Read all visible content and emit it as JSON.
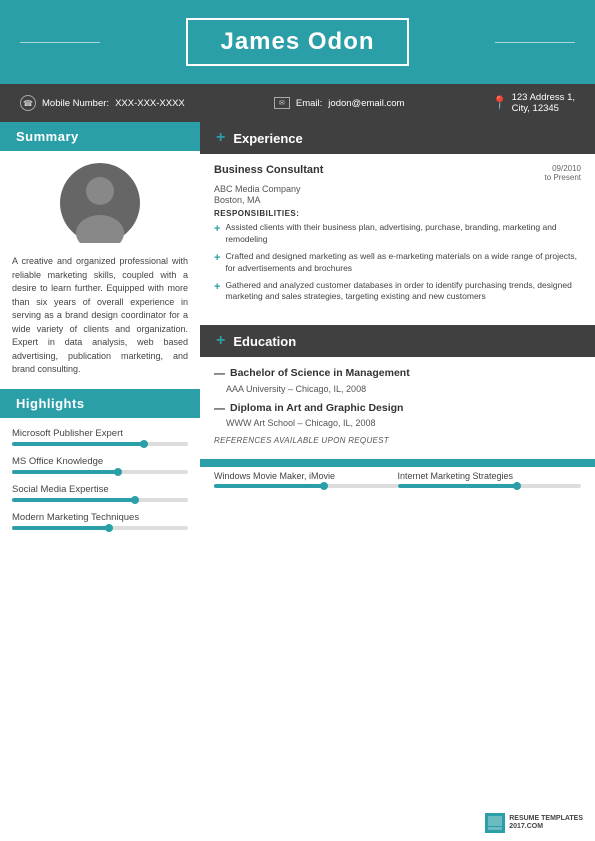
{
  "header": {
    "name": "James Odon"
  },
  "contact": {
    "phone_label": "Mobile Number:",
    "phone_value": "XXX-XXX-XXXX",
    "email_label": "Email:",
    "email_value": "jodon@email.com",
    "address_line1": "123 Address 1,",
    "address_line2": "City, 12345"
  },
  "summary": {
    "section_title": "Summary",
    "text": "A creative and organized professional with reliable marketing skills, coupled with a desire to learn further. Equipped with more than six years of overall experience in serving as a brand design coordinator for a wide variety of clients and organization. Expert in data analysis, web based advertising, publication marketing, and brand consulting."
  },
  "highlights": {
    "section_title": "Highlights",
    "items": [
      {
        "label": "Microsoft Publisher Expert",
        "percent": 75
      },
      {
        "label": "MS Office Knowledge",
        "percent": 60
      },
      {
        "label": "Social Media Expertise",
        "percent": 70
      },
      {
        "label": "Modern Marketing Techniques",
        "percent": 55
      }
    ]
  },
  "experience": {
    "section_title": "Experience",
    "jobs": [
      {
        "title": "Business Consultant",
        "date_start": "09/2010",
        "date_end": "to Present",
        "company": "ABC Media Company",
        "location": "Boston, MA",
        "responsibilities_label": "RESPONSIBILITIES:",
        "responsibilities": [
          "Assisted clients with their business plan, advertising, purchase, branding, marketing and remodeling",
          "Crafted and designed marketing as well as e-marketing materials on a wide range of projects, for advertisements and brochures",
          "Gathered and analyzed customer databases in order to identify purchasing trends, designed marketing and sales strategies, targeting existing and new customers"
        ]
      }
    ]
  },
  "education": {
    "section_title": "Education",
    "entries": [
      {
        "title": "Bachelor of Science in Management",
        "school": "AAA University – Chicago, IL, 2008"
      },
      {
        "title": "Diploma in Art and Graphic Design",
        "school": "WWW Art School – Chicago, IL, 2008"
      }
    ],
    "references": "REFERENCES AVAILABLE UPON REQUEST"
  },
  "bottom_skills": [
    {
      "label": "Windows Movie Maker, iMovie",
      "percent": 60
    },
    {
      "label": "Internet Marketing Strategies",
      "percent": 65
    }
  ],
  "watermark": {
    "line1": "RESUME TEMPLATES",
    "line2": "2017.COM"
  }
}
